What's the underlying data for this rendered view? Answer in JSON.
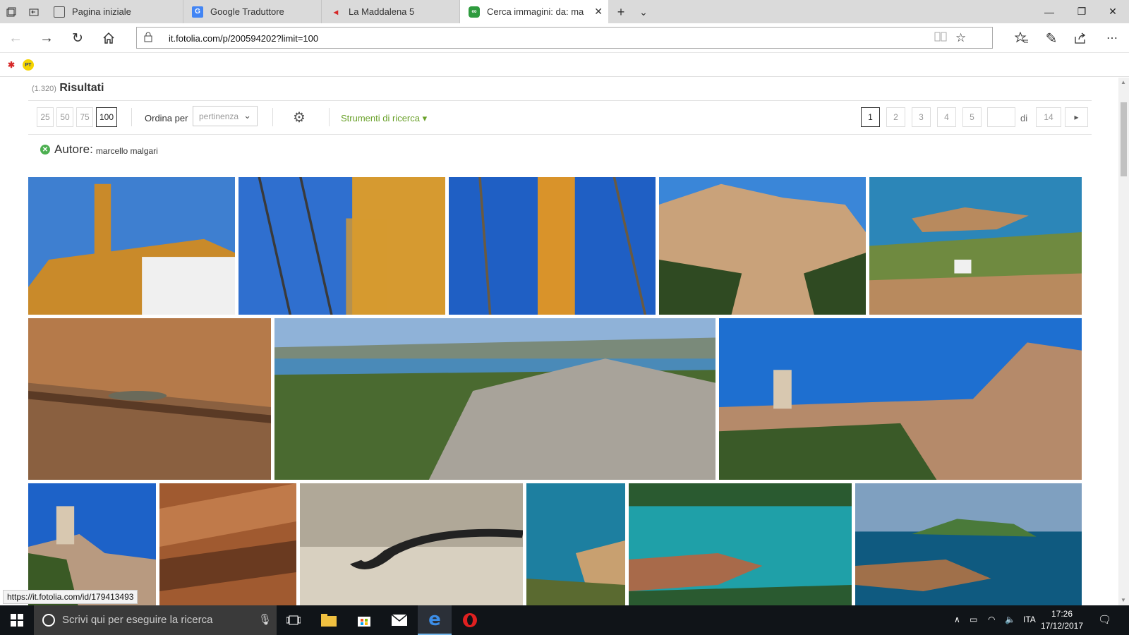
{
  "browser": {
    "tabs": [
      {
        "label": "Pagina iniziale"
      },
      {
        "label": "Google Traduttore"
      },
      {
        "label": "La Maddalena 5"
      },
      {
        "label": "Cerca immagini: da: ma"
      }
    ],
    "url": "it.fotolia.com/p/200594202?limit=100",
    "status_url": "https://it.fotolia.com/id/179413493",
    "favorites": [
      {
        "label": "PT"
      }
    ]
  },
  "results": {
    "count": "(1.320)",
    "title": "Risultati"
  },
  "toolbar": {
    "limits": [
      "25",
      "50",
      "75",
      "100"
    ],
    "active_limit": "100",
    "sort_label": "Ordina per",
    "sort_value": "pertinenza",
    "tools_label": "Strumenti di ricerca ▾"
  },
  "pagination": {
    "pages": [
      "1",
      "2",
      "3",
      "4",
      "5"
    ],
    "current": "1",
    "input_value": "",
    "of_label": "di",
    "total": "14",
    "next_icon": "▸"
  },
  "filter": {
    "label": "Autore:",
    "value": "marcello malgari"
  },
  "images": [
    {
      "subject": "ship-bridge",
      "colors": [
        "#3e7fd0",
        "#c98a2a",
        "#f0f0f0"
      ]
    },
    {
      "subject": "rigging-pulley",
      "colors": [
        "#2f6fcf",
        "#d69a30",
        "#3a3a3a"
      ]
    },
    {
      "subject": "mast-rigging",
      "colors": [
        "#1f5fc4",
        "#d9932a",
        "#6a5a40"
      ]
    },
    {
      "subject": "granite-rocks",
      "colors": [
        "#3a86d8",
        "#c9a27a",
        "#2f4a22"
      ]
    },
    {
      "subject": "coast-vehicle",
      "colors": [
        "#2c86b8",
        "#b88a5e",
        "#6f8a40"
      ]
    },
    {
      "subject": "lizard-rock",
      "colors": [
        "#8a6040",
        "#b57a4a",
        "#5a3a25"
      ]
    },
    {
      "subject": "island-landscape",
      "colors": [
        "#8fb2d8",
        "#a8a39a",
        "#4a6a30"
      ]
    },
    {
      "subject": "tower-rocks",
      "colors": [
        "#1e6fd0",
        "#b58a6a",
        "#3a5a28"
      ]
    },
    {
      "subject": "tower-hill",
      "colors": [
        "#1d62c8",
        "#b89a80",
        "#3a5a25"
      ]
    },
    {
      "subject": "rock-texture",
      "colors": [
        "#a05a30",
        "#c07a4a",
        "#6a3a20"
      ]
    },
    {
      "subject": "snake",
      "colors": [
        "#b0a898",
        "#d8d0c0",
        "#222222"
      ]
    },
    {
      "subject": "beach-cove",
      "colors": [
        "#1d7fa0",
        "#c8a070",
        "#5a6a30"
      ]
    },
    {
      "subject": "sea-rocks",
      "colors": [
        "#1fa0a8",
        "#a86a4a",
        "#2a5a30"
      ]
    },
    {
      "subject": "islet-sea",
      "colors": [
        "#7fa0c0",
        "#0f5a80",
        "#a0704a"
      ]
    }
  ],
  "taskbar": {
    "search_placeholder": "Scrivi qui per eseguire la ricerca",
    "language": "ITA",
    "time": "17:26",
    "date": "17/12/2017"
  }
}
